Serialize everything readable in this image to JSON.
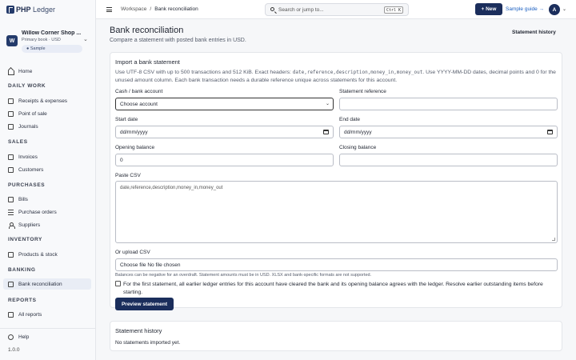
{
  "app": {
    "logo_bold": "PHP",
    "logo_rest": " Ledger"
  },
  "org": {
    "avatar": "W",
    "name": "Willow Corner Shop ...",
    "sub": "Primary book · USD",
    "badge": "● Sample"
  },
  "sidebar": {
    "home": "Home",
    "sections": {
      "daily_work": "DAILY WORK",
      "sales": "SALES",
      "purchases": "PURCHASES",
      "inventory": "INVENTORY",
      "banking": "BANKING",
      "reports": "REPORTS"
    },
    "items": {
      "receipts": "Receipts & expenses",
      "pos": "Point of sale",
      "journals": "Journals",
      "invoices": "Invoices",
      "customers": "Customers",
      "bills": "Bills",
      "purchase_orders": "Purchase orders",
      "suppliers": "Suppliers",
      "products": "Products & stock",
      "bank_recon": "Bank reconciliation",
      "all_reports": "All reports"
    },
    "help": "Help",
    "version": "1.0.0"
  },
  "topbar": {
    "breadcrumb_root": "Workspace",
    "breadcrumb_sep": "/",
    "breadcrumb_current": "Bank reconciliation",
    "search_placeholder": "Search or jump to...",
    "search_shortcut": "Ctrl K",
    "new_label": "+ New",
    "guide_label": "Sample guide →",
    "user_initial": "A",
    "user_chev": "⌄"
  },
  "page": {
    "title": "Bank reconciliation",
    "subtitle": "Compare a statement with posted bank entries in USD.",
    "history_link": "Statement history"
  },
  "import": {
    "title": "Import a bank statement",
    "desc_1": "Use UTF-8 CSV with up to 500 transactions and 512 KiB. Exact headers: ",
    "desc_headers": "date,reference,description,money_in,money_out",
    "desc_2": ". Use YYYY-MM-DD dates, decimal points and 0 for the unused amount column. Each bank transaction needs a durable reference unique across statements for this account.",
    "account_label": "Cash / bank account",
    "account_value": "Choose account",
    "reference_label": "Statement reference",
    "reference_value": "",
    "start_label": "Start date",
    "start_value": "dd/mm/yyyy",
    "end_label": "End date",
    "end_value": "dd/mm/yyyy",
    "opening_label": "Opening balance",
    "opening_value": "0",
    "closing_label": "Closing balance",
    "closing_value": "",
    "csv_label": "Paste CSV",
    "csv_placeholder": "date,reference,description,money_in,money_out",
    "upload_label": "Or upload CSV",
    "upload_value": "Choose file No file chosen",
    "help_text": "Balances can be negative for an overdraft. Statement amounts must be in USD. XLSX and bank-specific formats are not supported.",
    "checkbox_label": "For the first statement, all earlier ledger entries for this account have cleared the bank and its opening balance agrees with the ledger. Resolve earlier outstanding items before starting.",
    "preview_button": "Preview statement"
  },
  "history": {
    "title": "Statement history",
    "empty": "No statements imported yet."
  }
}
